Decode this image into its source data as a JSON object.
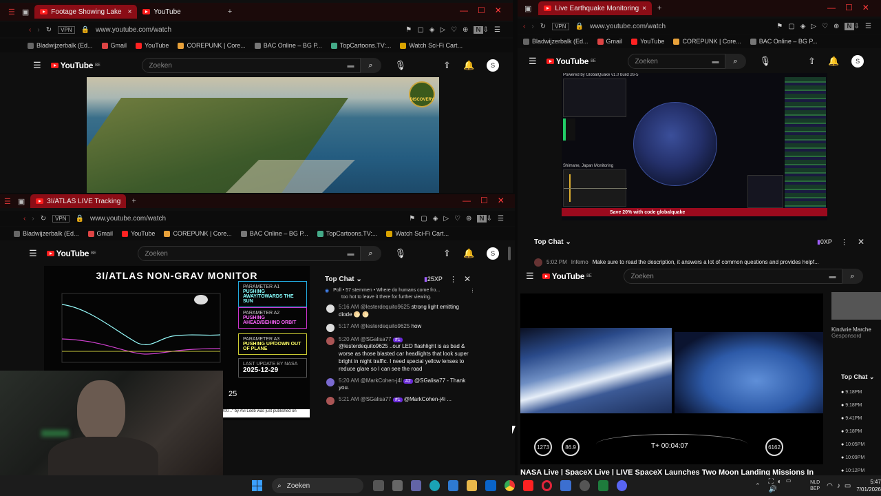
{
  "win1": {
    "tab_active": "Footage Showing Lake",
    "tab2": "YouTube",
    "url": "www.youtube.com/watch",
    "search_placeholder": "Zoeken",
    "youtube_logo": "YouTube",
    "region": "BE",
    "avatar": "S",
    "discovery_logo": "DISCOVERY"
  },
  "win2": {
    "tab_active": "Live Earthquake Monitoring",
    "url": "www.youtube.com/watch",
    "search_placeholder": "Zoeken",
    "youtube_logo": "YouTube",
    "region": "BE",
    "avatar": "S",
    "eq_header": "Powered by GlobalQuake v1.0 build 26-5",
    "eq_region": "Shimane, Japan Monitoring",
    "promo": "Save 20% with code globalquake",
    "chat": {
      "title": "Top Chat",
      "xp": "0XP",
      "time": "5:02 PM",
      "name": "Inferno",
      "message": "Make sure to read the description, it answers a lot of common questions and provides helpf..."
    }
  },
  "win3": {
    "tab_active": "3I/ATLAS LIVE Tracking",
    "url": "www.youtube.com/watch",
    "search_placeholder": "Zoeken",
    "youtube_logo": "YouTube",
    "region": "BE",
    "avatar": "S",
    "monitor_title": "3I/ATLAS NON-GRAV MONITOR",
    "params": [
      {
        "title": "PARAMETER A1",
        "value": "PUSHING AWAY/TOWARDS THE SUN"
      },
      {
        "title": "PARAMETER A2",
        "value": "PUSHING AHEAD/BEHIND ORBIT"
      },
      {
        "title": "PARAMETER A3",
        "value": "PUSHING UP/DOWN OUT OF PLANE"
      }
    ],
    "last_update_label": "LAST UPDATE BY NASA",
    "last_update": "2025-12-29",
    "count": "25",
    "ticker": "000...\" by Avi Loeb was just published on",
    "chat": {
      "title": "Top Chat",
      "xp": "25XP",
      "poll": "Poll • 57 stemmen • Where do humans come fro...",
      "intro": "too hot to leave it there for further viewing.",
      "messages": [
        {
          "time": "5:16 AM",
          "name": "@lesterdequito9625",
          "text": "strong light emitting diode 🌕 🌕"
        },
        {
          "time": "5:17 AM",
          "name": "@lesterdequito9625",
          "text": "how"
        },
        {
          "time": "5:20 AM",
          "name": "@SGalisa77",
          "badge": "#1",
          "text": "@lesterdequito9625 ..our LED flashlight is as bad & worse as those blasted car headlights that look super bright in night traffic. I need special yellow lenses to reduce glare so I can see the road"
        },
        {
          "time": "5:20 AM",
          "name": "@MarkCohen-j4l",
          "badge": "#2",
          "text": "@SGalisa77 - Thank you."
        },
        {
          "time": "5:21 AM",
          "name": "@SGalisa77",
          "badge": "#1",
          "text": "@MarkCohen-j4i ..."
        }
      ]
    }
  },
  "win4": {
    "search_placeholder": "Zoeken",
    "youtube_logo": "YouTube",
    "region": "BE",
    "speed": "1273",
    "altitude": "86.9",
    "timer": "T+ 00:04:07",
    "speed2": "6162",
    "video_title": "NASA Live | SpaceX Live | LIVE SpaceX Launches Two Moon Landing Missions In",
    "side_chat_title": "Top Chat",
    "side_times": [
      "9:18PM",
      "9:18PM",
      "9:41PM",
      "9:18PM",
      "10:05PM",
      "10:09PM",
      "10:12PM"
    ],
    "side_label": "Kindvrie Marche",
    "side_sub": "Gesponsord"
  },
  "bookmarks": [
    "Bladwijzerbalk (Ed...",
    "Gmail",
    "YouTube",
    "COREPUNK | Core...",
    "BAC Online – BG P...",
    "TopCartoons.TV:...",
    "Watch Sci-Fi Cart..."
  ],
  "taskbar": {
    "search": "Zoeken",
    "lang": "NLD",
    "lang2": "BEP",
    "time": "5:47",
    "date": "7/01/2026"
  }
}
